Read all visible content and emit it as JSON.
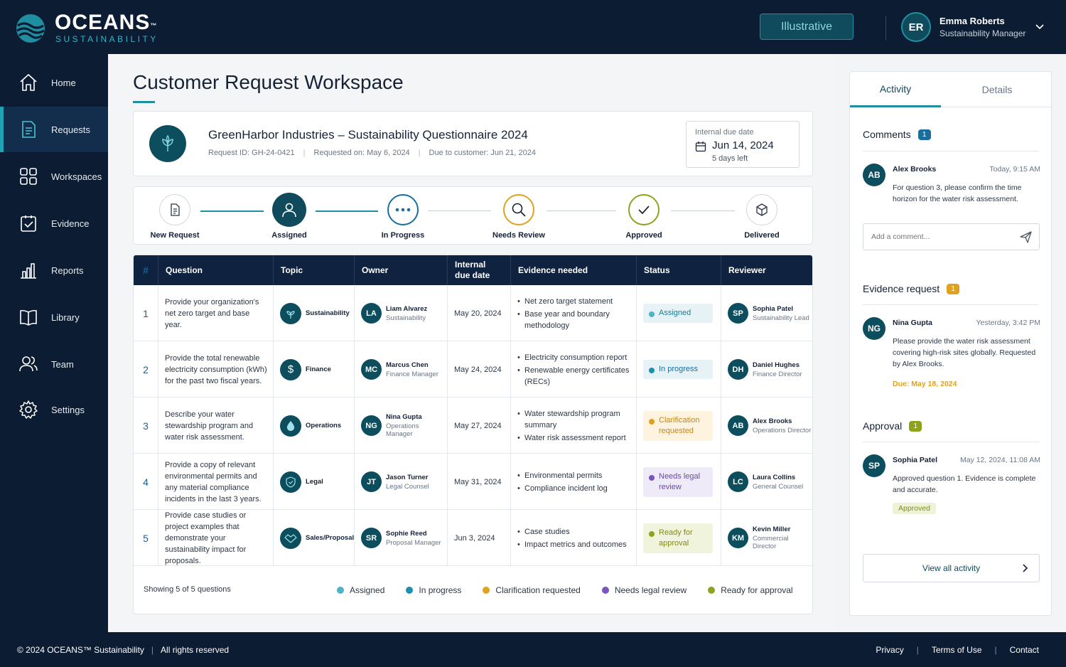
{
  "brand": {
    "name": "OCEANS",
    "tm": "™",
    "tagline": "SUSTAINABILITY"
  },
  "header": {
    "illustrative_label": "Illustrative",
    "user": {
      "initials": "ER",
      "name": "Emma Roberts",
      "role": "Sustainability Manager"
    }
  },
  "sidebar": {
    "items": [
      {
        "label": "Home",
        "icon": "home-icon"
      },
      {
        "label": "Requests",
        "icon": "document-icon",
        "active": true
      },
      {
        "label": "Workspaces",
        "icon": "grid-icon"
      },
      {
        "label": "Evidence",
        "icon": "clipboard-check-icon"
      },
      {
        "label": "Reports",
        "icon": "bar-chart-icon"
      },
      {
        "label": "Library",
        "icon": "book-icon"
      },
      {
        "label": "Team",
        "icon": "users-icon"
      },
      {
        "label": "Settings",
        "icon": "gear-icon"
      }
    ]
  },
  "main": {
    "title": "Customer Request Workspace",
    "request": {
      "title": "GreenHarbor Industries – Sustainability Questionnaire 2024",
      "id": "Request ID: GH-24-0421",
      "requested_on": "Requested on: May 6, 2024",
      "due_to_customer": "Due to customer: Jun 21, 2024",
      "internal_due_label": "Internal due date",
      "internal_due_date": "Jun 14, 2024",
      "days_left": "5 days left"
    },
    "steps": [
      "New Request",
      "Assigned",
      "In Progress",
      "Needs Review",
      "Approved",
      "Delivered"
    ],
    "table": {
      "headers": [
        "#",
        "Question",
        "Topic",
        "Owner",
        "Internal due date",
        "Evidence needed",
        "Status",
        "Reviewer"
      ],
      "rows": [
        {
          "num": "1",
          "question": "Provide your organization's net zero target and base year.",
          "topic": "Sustainability",
          "owner": {
            "initials": "LA",
            "name": "Liam Alvarez",
            "role": "Sustainability"
          },
          "due": "May 20, 2024",
          "evidence": [
            "Net zero target statement",
            "Base year and boundary methodology"
          ],
          "status": "Assigned",
          "reviewer": {
            "initials": "SP",
            "name": "Sophia Patel",
            "role": "Sustainability Lead"
          }
        },
        {
          "num": "2",
          "question": "Provide the total renewable electricity consumption (kWh) for the past two fiscal years.",
          "topic": "Finance",
          "owner": {
            "initials": "MC",
            "name": "Marcus Chen",
            "role": "Finance Manager"
          },
          "due": "May 24, 2024",
          "evidence": [
            "Electricity consumption report",
            "Renewable energy certificates (RECs)"
          ],
          "status": "In progress",
          "reviewer": {
            "initials": "DH",
            "name": "Daniel Hughes",
            "role": "Finance Director"
          }
        },
        {
          "num": "3",
          "question": "Describe your water stewardship program and water risk assessment.",
          "topic": "Operations",
          "owner": {
            "initials": "NG",
            "name": "Nina Gupta",
            "role": "Operations Manager"
          },
          "due": "May 27, 2024",
          "evidence": [
            "Water stewardship program summary",
            "Water risk assessment report"
          ],
          "status": "Clarification requested",
          "reviewer": {
            "initials": "AB",
            "name": "Alex Brooks",
            "role": "Operations Director"
          }
        },
        {
          "num": "4",
          "question": "Provide a copy of relevant environmental permits and any material compliance incidents in the last 3 years.",
          "topic": "Legal",
          "owner": {
            "initials": "JT",
            "name": "Jason Turner",
            "role": "Legal Counsel"
          },
          "due": "May 31, 2024",
          "evidence": [
            "Environmental permits",
            "Compliance incident log"
          ],
          "status": "Needs legal review",
          "reviewer": {
            "initials": "LC",
            "name": "Laura Collins",
            "role": "General Counsel"
          }
        },
        {
          "num": "5",
          "question": "Provide case studies or project examples that demonstrate your sustainability impact for proposals.",
          "topic": "Sales/Proposal",
          "owner": {
            "initials": "SR",
            "name": "Sophie Reed",
            "role": "Proposal Manager"
          },
          "due": "Jun 3, 2024",
          "evidence": [
            "Case studies",
            "Impact metrics and outcomes"
          ],
          "status": "Ready for approval",
          "reviewer": {
            "initials": "KM",
            "name": "Kevin Miller",
            "role": "Commercial Director"
          }
        }
      ],
      "showing": "Showing 5 of 5 questions",
      "legend": [
        {
          "label": "Assigned",
          "color": "#4fb3c6"
        },
        {
          "label": "In progress",
          "color": "#1a8fb0"
        },
        {
          "label": "Clarification requested",
          "color": "#e0a21e"
        },
        {
          "label": "Needs legal review",
          "color": "#7a55c2"
        },
        {
          "label": "Ready for approval",
          "color": "#8fa21e"
        }
      ]
    }
  },
  "panel": {
    "tabs": [
      "Activity",
      "Details"
    ],
    "comments": {
      "title": "Comments",
      "count": "1",
      "item": {
        "initials": "AB",
        "name": "Alex Brooks",
        "time": "Today, 9:15 AM",
        "text": "For question 3, please confirm the time horizon for the water risk assessment."
      },
      "placeholder": "Add a comment..."
    },
    "evidence": {
      "title": "Evidence request",
      "count": "1",
      "item": {
        "initials": "NG",
        "name": "Nina Gupta",
        "time": "Yesterday, 3:42 PM",
        "text": "Please provide the water risk assessment covering high-risk sites globally. Requested by Alex Brooks.",
        "due": "Due: May 18, 2024"
      }
    },
    "approval": {
      "title": "Approval",
      "count": "1",
      "item": {
        "initials": "SP",
        "name": "Sophia Patel",
        "time": "May 12, 2024, 11:08 AM",
        "text": "Approved question 1. Evidence is complete and accurate.",
        "chip": "Approved"
      }
    },
    "view_all": "View all activity"
  },
  "footer": {
    "copyright": "© 2024 OCEANS™ Sustainability",
    "rights": "All rights reserved",
    "links": [
      "Privacy",
      "Terms of Use",
      "Contact"
    ]
  },
  "colors": {
    "navy": "#0c1c33",
    "teal": "#1f8ea0",
    "badge_blue": "#1a6e9c",
    "badge_orange": "#e0a21e",
    "badge_green": "#8fa21e"
  }
}
